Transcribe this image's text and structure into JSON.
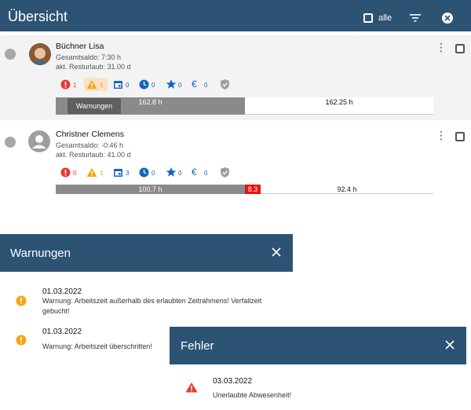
{
  "header": {
    "title": "Übersicht",
    "all_label": "alle"
  },
  "persons": [
    {
      "name": "Büchner Lisa",
      "saldo": "Gesamtsaldo: 7:30 h",
      "urlaub": "akt. Resturlaub: 31.00 d",
      "badges": [
        "1",
        "1",
        "0",
        "0",
        "0",
        "0"
      ],
      "bar": {
        "planned": "162.8 h",
        "extra": "",
        "remaining": "162.25 h",
        "tooltip": "Warnungen"
      }
    },
    {
      "name": "Christner Clemens",
      "saldo": "Gesamtsaldo: -0:46 h",
      "urlaub": "akt. Resturlaub: 41.00 d",
      "badges": [
        "0",
        "1",
        "3",
        "0",
        "0",
        "0"
      ],
      "bar": {
        "planned": "100.7 h",
        "extra": "8.3 h",
        "remaining": "92.4 h"
      }
    }
  ],
  "warnings_dialog": {
    "title": "Warnungen",
    "items": [
      {
        "date": "01.03.2022",
        "text": "Warnung: Arbeitszeit außerhalb des erlaubten Zeitrahmens! Verfallzeit gebucht!"
      },
      {
        "date": "01.03.2022",
        "text": "Warnung: Arbeitszeit überschritten!"
      }
    ]
  },
  "errors_dialog": {
    "title": "Fehler",
    "items": [
      {
        "date": "03.03.2022",
        "text": "Unerlaubte Abwesenheit!"
      }
    ]
  },
  "colors": {
    "primary": "#2d5374",
    "error": "#e53935",
    "warning": "#f3a712",
    "info": "#1565c0",
    "bar_gray": "#8a8a8a"
  },
  "icons": [
    "error-icon",
    "warning-icon",
    "calendar-icon",
    "clock-icon",
    "star-icon",
    "euro-icon",
    "shield-icon"
  ]
}
